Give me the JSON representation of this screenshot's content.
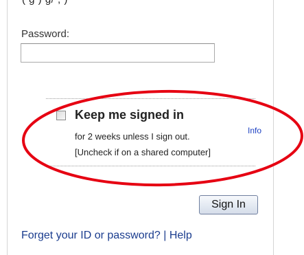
{
  "header": {
    "cut_text": "( g   ) g/ ,   )"
  },
  "password": {
    "label": "Password:",
    "value": "",
    "placeholder": ""
  },
  "keep_signed_in": {
    "label": "Keep me signed in",
    "checked": false,
    "duration_text": "for 2 weeks unless I sign out.",
    "info_link": "Info",
    "warning_text": "[Uncheck if on a shared computer]"
  },
  "actions": {
    "sign_in_label": "Sign In"
  },
  "footer": {
    "forgot_link": "Forget your ID or password?",
    "separator": "|",
    "help_link": "Help"
  },
  "colors": {
    "highlight_ellipse": "#e60012",
    "link": "#1a3c8e",
    "info_link": "#1a3fc2"
  },
  "icons": {
    "checkbox": "checkbox-unchecked-icon"
  }
}
